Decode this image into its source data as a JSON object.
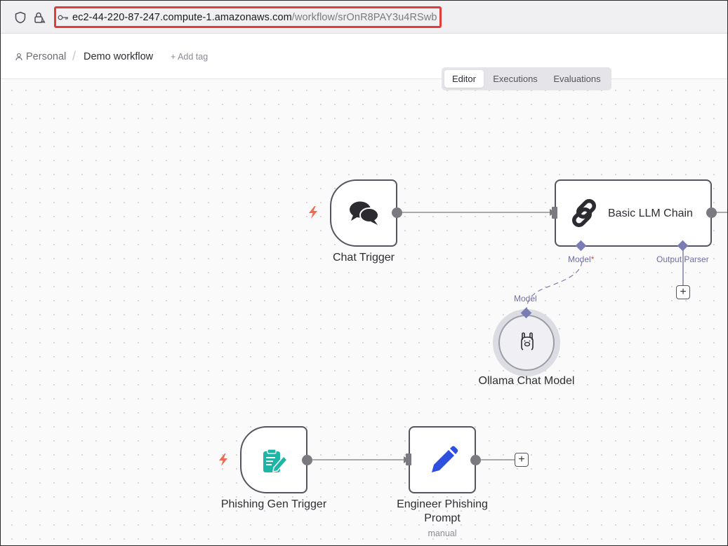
{
  "browser": {
    "url_host": "ec2-44-220-87-247.compute-1.amazonaws.com",
    "url_path": "/workflow/srOnR8PAY3u4RSwb",
    "highlight_color": "#e03c3c"
  },
  "header": {
    "project": "Personal",
    "separator": "/",
    "workflow_name": "Demo workflow",
    "add_tag": "+ Add tag"
  },
  "view_tabs": [
    {
      "label": "Editor",
      "active": true
    },
    {
      "label": "Executions",
      "active": false
    },
    {
      "label": "Evaluations",
      "active": false
    }
  ],
  "nodes": {
    "chat_trigger": {
      "label": "Chat Trigger",
      "icon": "chat-bubbles-icon"
    },
    "llm_chain": {
      "label": "Basic LLM Chain",
      "icon": "chain-link-icon"
    },
    "ollama": {
      "label": "Ollama Chat Model",
      "icon": "llama-icon"
    },
    "phishing_trigger": {
      "label": "Phishing Gen Trigger",
      "icon": "form-edit-icon"
    },
    "engineer_prompt": {
      "label_line1": "Engineer Phishing",
      "label_line2": "Prompt",
      "sublabel": "manual",
      "icon": "pencil-icon"
    }
  },
  "ports": {
    "model": "Model",
    "model_required": "*",
    "output_parser": "Output Parser",
    "ollama_model": "Model"
  },
  "colors": {
    "trigger_bolt": "#ef6a52",
    "port_diamond": "#7c7cb4",
    "form_icon": "#1fb5a6",
    "pencil_icon": "#2e4fe0"
  }
}
